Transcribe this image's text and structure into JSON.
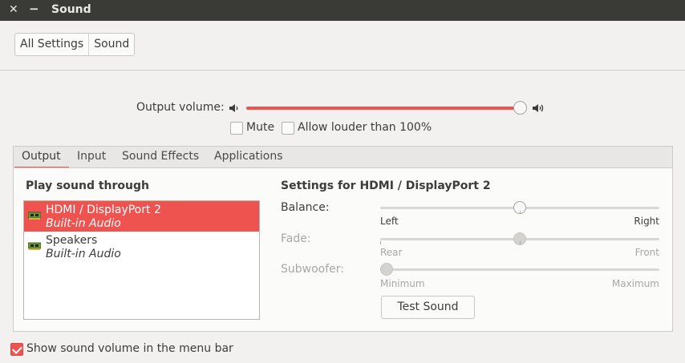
{
  "window": {
    "title": "Sound",
    "close_glyph": "✕",
    "minimize_glyph": "−"
  },
  "breadcrumb": {
    "items": [
      "All Settings",
      "Sound"
    ]
  },
  "output_volume": {
    "label": "Output volume:",
    "level_percent": 100,
    "low_icon": "speaker-low-icon",
    "high_icon": "speaker-high-icon"
  },
  "options": {
    "mute": "Mute",
    "mute_checked": false,
    "allow_louder": "Allow louder than 100%",
    "allow_louder_checked": false
  },
  "tabs": [
    {
      "label": "Output",
      "active": true
    },
    {
      "label": "Input",
      "active": false
    },
    {
      "label": "Sound Effects",
      "active": false
    },
    {
      "label": "Applications",
      "active": false
    }
  ],
  "output": {
    "play_heading": "Play sound through",
    "devices": [
      {
        "name": "HDMI / DisplayPort 2",
        "sub": "Built-in Audio",
        "selected": true,
        "icon": "sound-card-icon"
      },
      {
        "name": "Speakers",
        "sub": "Built-in Audio",
        "selected": false,
        "icon": "sound-card-icon"
      }
    ],
    "settings_heading": "Settings for HDMI / DisplayPort 2",
    "balance": {
      "label": "Balance:",
      "left": "Left",
      "right": "Right",
      "value": 0.5,
      "enabled": true
    },
    "fade": {
      "label": "Fade:",
      "left": "Rear",
      "right": "Front",
      "value": 0.5,
      "enabled": false
    },
    "subwoofer": {
      "label": "Subwoofer:",
      "left": "Minimum",
      "right": "Maximum",
      "value": 0.0,
      "enabled": false
    },
    "test_button": "Test Sound"
  },
  "footer": {
    "show_in_menubar": "Show sound volume in the menu bar",
    "show_in_menubar_checked": true
  },
  "colors": {
    "accent": "#ef5350",
    "titlebar": "#3a3a37",
    "background": "#f2f1f0"
  }
}
